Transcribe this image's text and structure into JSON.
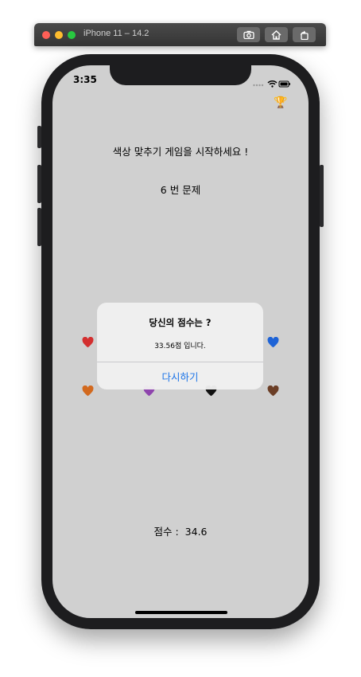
{
  "simulator": {
    "title": "iPhone 11 – 14.2",
    "buttons": [
      "screenshot-icon",
      "home-icon",
      "rotate-icon"
    ]
  },
  "status_bar": {
    "time": "3:35"
  },
  "game": {
    "title": "색상 맞추기 게임을 시작하세요 !",
    "question": "6 번 문제",
    "score_label": "점수 :",
    "score_value": "34.6"
  },
  "hearts": [
    {
      "name": "red-heart-icon",
      "color": "#d32f2f"
    },
    {
      "name": "blue-heart-icon",
      "color": "#1e63d6"
    },
    {
      "name": "orange-heart-icon",
      "color": "#d2691e"
    },
    {
      "name": "purple-heart-icon",
      "color": "#8e44ad"
    },
    {
      "name": "black-heart-icon",
      "color": "#111111"
    },
    {
      "name": "brown-heart-icon",
      "color": "#6b3e26"
    }
  ],
  "alert": {
    "title": "당신의 점수는 ?",
    "message": "33.56점 입니다.",
    "button_label": "다시하기"
  },
  "colors": {
    "screen_bg": "#d0d0d0",
    "accent": "#1a73e8"
  }
}
